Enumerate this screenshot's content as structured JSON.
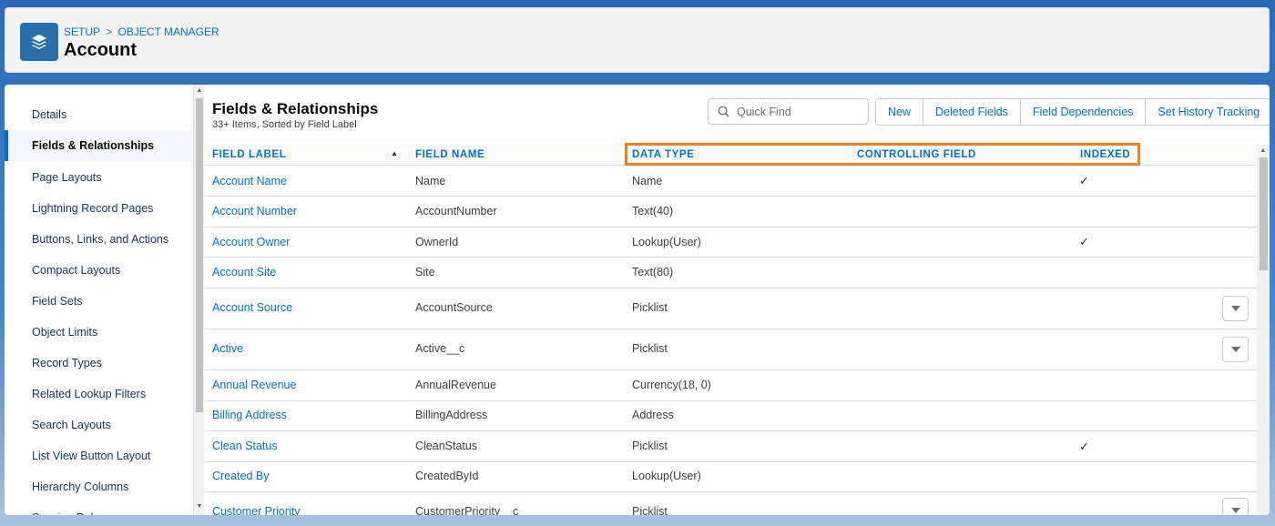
{
  "header": {
    "breadcrumb": {
      "part1": "SETUP",
      "separator": ">",
      "part2": "OBJECT MANAGER"
    },
    "title": "Account",
    "icon": "layers-icon"
  },
  "sidebar": {
    "items": [
      {
        "label": "Details"
      },
      {
        "label": "Fields & Relationships",
        "active": true
      },
      {
        "label": "Page Layouts"
      },
      {
        "label": "Lightning Record Pages"
      },
      {
        "label": "Buttons, Links, and Actions"
      },
      {
        "label": "Compact Layouts"
      },
      {
        "label": "Field Sets"
      },
      {
        "label": "Object Limits"
      },
      {
        "label": "Record Types"
      },
      {
        "label": "Related Lookup Filters"
      },
      {
        "label": "Search Layouts"
      },
      {
        "label": "List View Button Layout"
      },
      {
        "label": "Hierarchy Columns"
      },
      {
        "label": "Scoping Rules"
      }
    ]
  },
  "main": {
    "title": "Fields & Relationships",
    "subtitle": "33+ Items, Sorted by Field Label",
    "quick_find_placeholder": "Quick Find",
    "buttons": {
      "new": "New",
      "deleted_fields": "Deleted Fields",
      "field_dependencies": "Field Dependencies",
      "set_history_tracking": "Set History Tracking"
    },
    "columns": {
      "field_label": "FIELD LABEL",
      "field_name": "FIELD NAME",
      "data_type": "DATA TYPE",
      "controlling_field": "CONTROLLING FIELD",
      "indexed": "INDEXED"
    },
    "sort_indicator": "▲",
    "check_glyph": "✓",
    "rows": [
      {
        "label": "Account Name",
        "name": "Name",
        "type": "Name",
        "indexed": true,
        "menu": false
      },
      {
        "label": "Account Number",
        "name": "AccountNumber",
        "type": "Text(40)",
        "indexed": false,
        "menu": false
      },
      {
        "label": "Account Owner",
        "name": "OwnerId",
        "type": "Lookup(User)",
        "indexed": true,
        "menu": false
      },
      {
        "label": "Account Site",
        "name": "Site",
        "type": "Text(80)",
        "indexed": false,
        "menu": false
      },
      {
        "label": "Account Source",
        "name": "AccountSource",
        "type": "Picklist",
        "indexed": false,
        "menu": true
      },
      {
        "label": "Active",
        "name": "Active__c",
        "type": "Picklist",
        "indexed": false,
        "menu": true
      },
      {
        "label": "Annual Revenue",
        "name": "AnnualRevenue",
        "type": "Currency(18, 0)",
        "indexed": false,
        "menu": false
      },
      {
        "label": "Billing Address",
        "name": "BillingAddress",
        "type": "Address",
        "indexed": false,
        "menu": false
      },
      {
        "label": "Clean Status",
        "name": "CleanStatus",
        "type": "Picklist",
        "indexed": true,
        "menu": false
      },
      {
        "label": "Created By",
        "name": "CreatedById",
        "type": "Lookup(User)",
        "indexed": false,
        "menu": false
      },
      {
        "label": "Customer Priority",
        "name": "CustomerPriority__c",
        "type": "Picklist",
        "indexed": false,
        "menu": true
      }
    ]
  },
  "colors": {
    "accent": "#0070d2",
    "highlight": "#f07f1f",
    "icon_bg": "#2a6fa8"
  }
}
